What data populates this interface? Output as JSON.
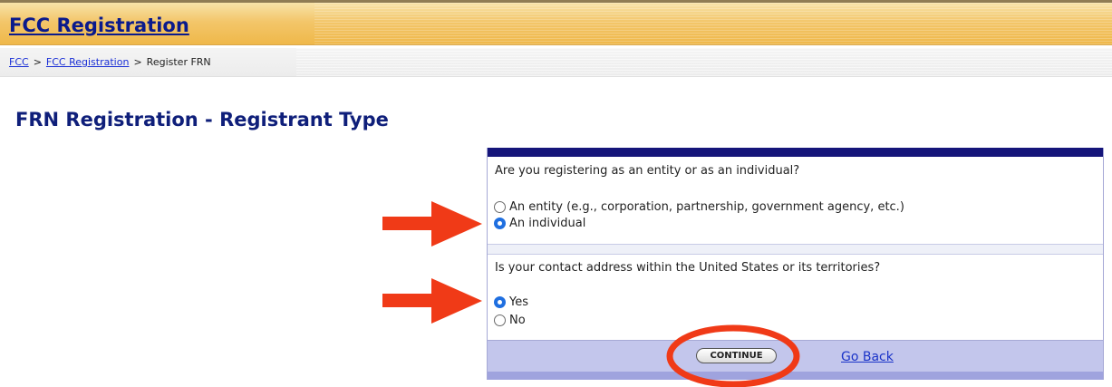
{
  "header": {
    "title": "FCC Registration"
  },
  "breadcrumb": {
    "item1": "FCC",
    "sep1": ">",
    "item2": "FCC Registration",
    "sep2": ">",
    "current": "Register FRN"
  },
  "page": {
    "title": "FRN Registration - Registrant Type"
  },
  "form": {
    "q1": {
      "question": "Are you registering as an entity or as an individual?",
      "options": [
        {
          "label": "An entity (e.g., corporation, partnership, government agency, etc.)",
          "checked": false
        },
        {
          "label": "An individual",
          "checked": true
        }
      ]
    },
    "q2": {
      "question": "Is your contact address within the United States or its territories?",
      "options": [
        {
          "label": "Yes",
          "checked": true
        },
        {
          "label": "No",
          "checked": false
        }
      ]
    },
    "continue_label": "CONTINUE",
    "goback_label": "Go Back"
  },
  "annotations": {
    "arrow_color": "#f03a17",
    "circle_color": "#f03a17"
  }
}
